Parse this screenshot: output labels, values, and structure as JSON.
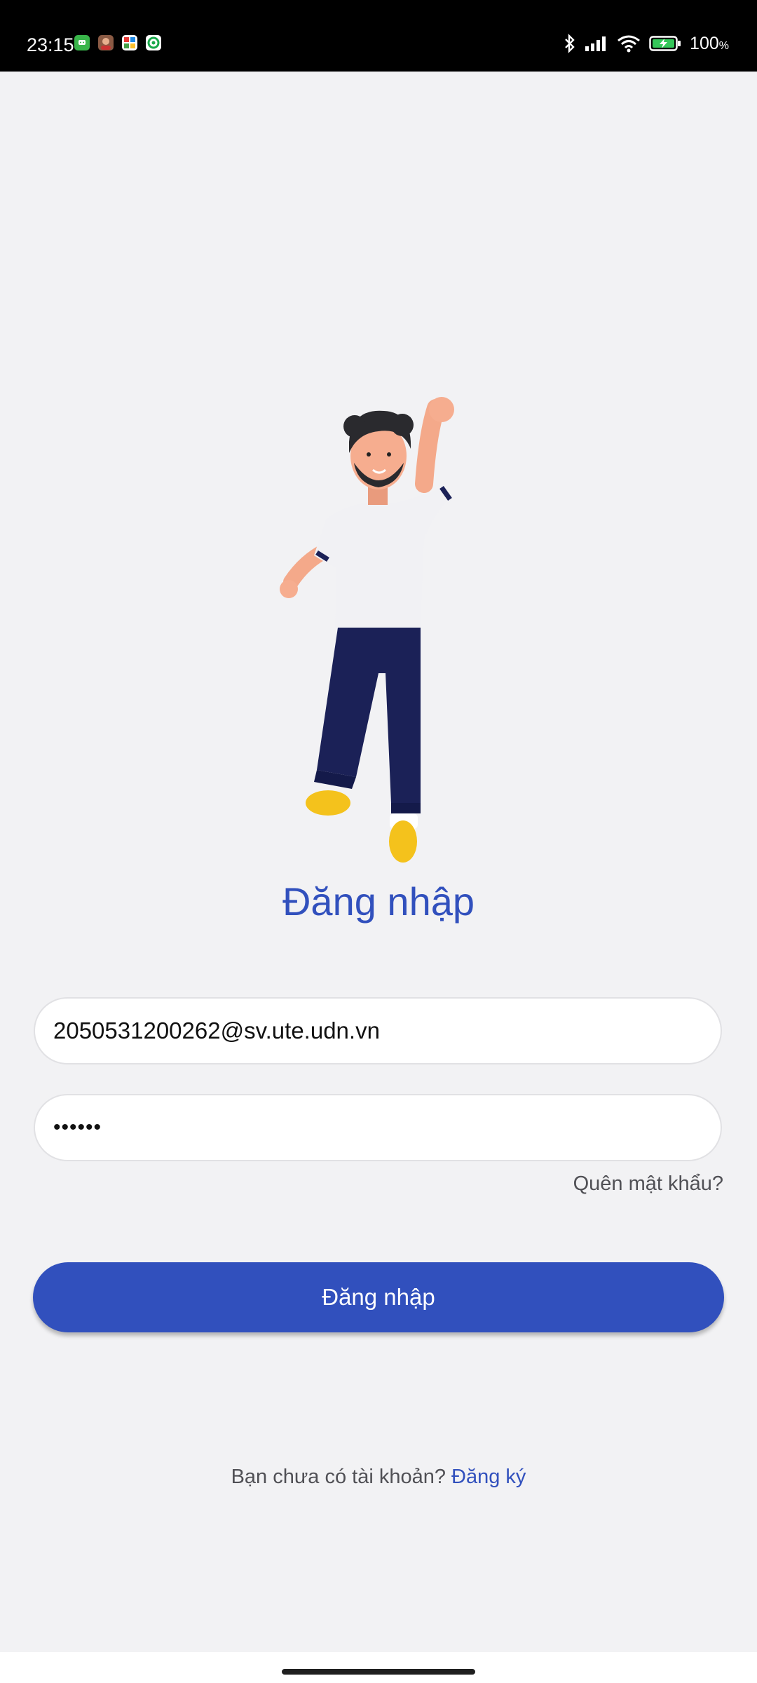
{
  "status_bar": {
    "time": "23:15",
    "battery": "100",
    "battery_unit": "%",
    "notification_icons": [
      "green-chat-icon",
      "avatar-app-icon",
      "colorful-app-icon",
      "green-circle-app-icon"
    ],
    "system_icons": [
      "bluetooth-icon",
      "signal-icon",
      "wifi-icon",
      "battery-charging-icon"
    ]
  },
  "illustration": "waving-man-3d-character",
  "login": {
    "title": "Đăng nhập",
    "email_value": "2050531200262@sv.ute.udn.vn",
    "password_mask": "••••••",
    "forgot_password": "Quên mật khẩu?",
    "submit_label": "Đăng nhập",
    "no_account_text": "Bạn chưa có tài khoản?",
    "signup_link": "Đăng ký"
  },
  "colors": {
    "primary": "#3150bd",
    "background": "#f2f2f4",
    "status_bar": "#000000",
    "secondary_text": "#505055"
  }
}
